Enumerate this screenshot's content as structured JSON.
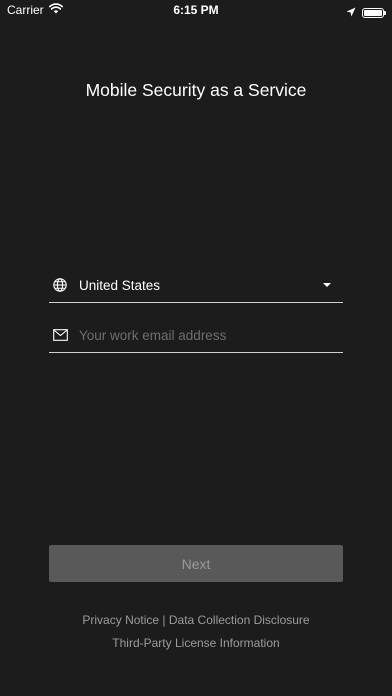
{
  "status_bar": {
    "carrier": "Carrier",
    "time": "6:15 PM"
  },
  "title": "Mobile Security as a Service",
  "country_field": {
    "value": "United States",
    "icon": "globe-icon"
  },
  "email_field": {
    "value": "",
    "placeholder": "Your work email address",
    "icon": "mail-icon"
  },
  "next_button": {
    "label": "Next"
  },
  "footer": {
    "privacy_notice": "Privacy Notice",
    "separator": "|",
    "data_collection": "Data Collection Disclosure",
    "third_party": "Third-Party License Information"
  },
  "colors": {
    "background": "#1c1c1c",
    "button_disabled": "#595959",
    "button_text_disabled": "#9a9a9a",
    "footer_text": "#9c9c9c",
    "placeholder": "#6e6e6e"
  }
}
